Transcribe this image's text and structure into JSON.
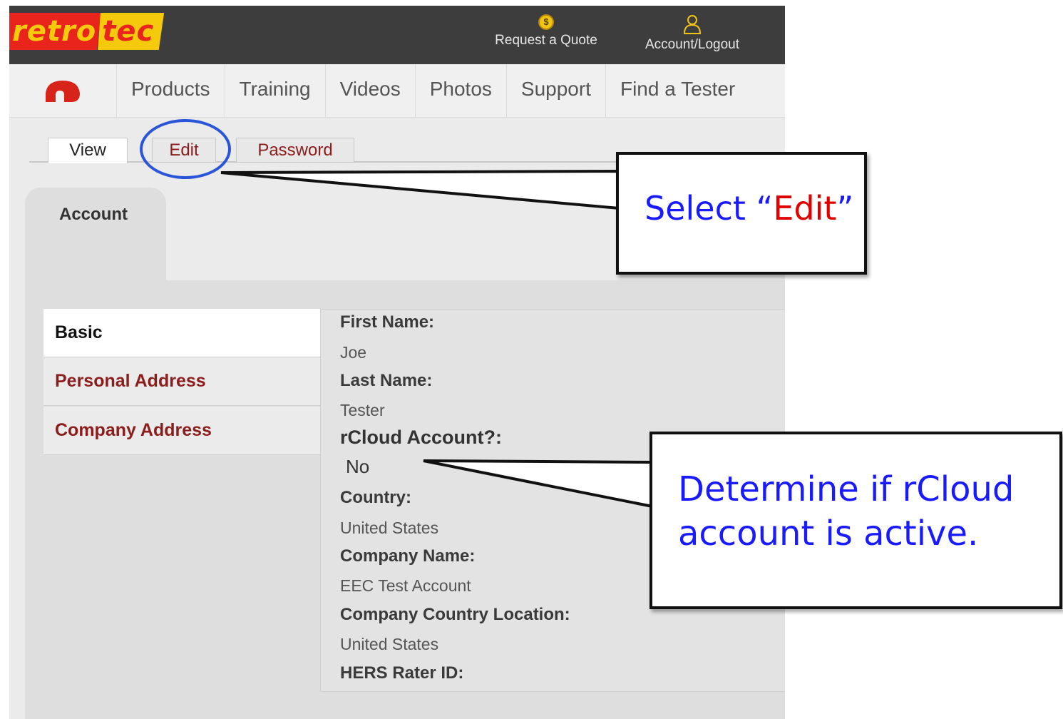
{
  "header": {
    "logo_left": "retro",
    "logo_right": "tec",
    "request_quote": "Request a Quote",
    "account_logout": "Account/Logout",
    "request_quote_icon": "dollar-coin-icon",
    "account_icon": "user-icon",
    "colors": {
      "bar": "#3d3d3d",
      "logo_red": "#e8241c",
      "logo_yellow": "#f5c90c"
    }
  },
  "nav": {
    "home_icon": "retrotec-home-icon",
    "items": [
      "Products",
      "Training",
      "Videos",
      "Photos",
      "Support",
      "Find a Tester"
    ]
  },
  "tabs": {
    "view": "View",
    "edit": "Edit",
    "password": "Password"
  },
  "account_tab": "Account",
  "sidebar": {
    "basic": "Basic",
    "personal": "Personal Address",
    "company": "Company Address"
  },
  "fields": {
    "first_name_label": "First Name:",
    "first_name": "Joe",
    "last_name_label": "Last Name:",
    "last_name": "Tester",
    "rcloud_label": "rCloud Account?:",
    "rcloud": "No",
    "country_label": "Country:",
    "country": "United States",
    "company_name_label": "Company Name:",
    "company_name": "EEC Test Account",
    "company_country_label": "Company Country Location:",
    "company_country": "United States",
    "hers_label": "HERS Rater ID:"
  },
  "annotations": {
    "callout1_prefix": "Select “",
    "callout1_highlight": "Edit",
    "callout1_suffix": "”",
    "callout2": "Determine if rCloud account is active.",
    "text_color": "#1a1aff",
    "highlight_color": "#e00000",
    "circle_color": "#2b55d9"
  }
}
